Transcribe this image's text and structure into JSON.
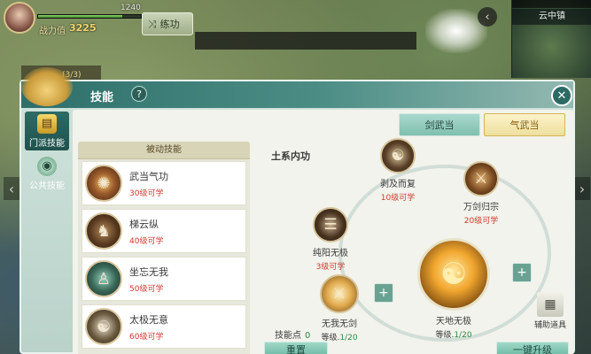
{
  "hud": {
    "hp_value": "1240",
    "hp_fraction": 0.82,
    "power_label": "战力值",
    "power_value": "3225",
    "practice_label": "练功",
    "quest_tab_label": "(3/3)"
  },
  "minimap": {
    "location": "云中镇"
  },
  "panel": {
    "title": "技能",
    "help_glyph": "?",
    "close_glyph": "✕",
    "side_tabs": [
      {
        "label": "门派技能",
        "icon": "scroll-icon"
      },
      {
        "label": "公共技能",
        "icon": "orb-icon"
      }
    ],
    "sect_buttons": {
      "sword": "剑武当",
      "qi": "气武当"
    },
    "passive": {
      "header": "被动技能",
      "items": [
        {
          "name": "武当气功",
          "requirement": "30级可学",
          "icon": "wudang-qigong-icon"
        },
        {
          "name": "梯云纵",
          "requirement": "40级可学",
          "icon": "tiyunzong-icon"
        },
        {
          "name": "坐忘无我",
          "requirement": "50级可学",
          "icon": "meditation-icon"
        },
        {
          "name": "太极无意",
          "requirement": "60级可学",
          "icon": "taiji-icon"
        }
      ]
    },
    "tree": {
      "title": "土系内功",
      "nodes": {
        "bofu": {
          "name": "剥及而复",
          "requirement": "10级可学"
        },
        "wanjian": {
          "name": "万剑归宗",
          "requirement": "20级可学"
        },
        "chunyang": {
          "name": "纯阳无极",
          "requirement": "3级可学"
        },
        "wuwujian": {
          "name": "无我无剑",
          "level_label": "等级.",
          "level": "1/20"
        },
        "tiandi": {
          "name": "天地无极",
          "level_label": "等级.",
          "level": "1/20"
        }
      }
    },
    "aux_tool_label": "辅助道具",
    "skill_points_label": "技能点",
    "skill_points_value": "0",
    "reset_label": "重置",
    "upgrade_all_label": "一键升级"
  },
  "colors": {
    "header": "#2f6f6a",
    "accent_gold": "#eedf9e",
    "requirement_red": "#d03a2c",
    "level_green": "#2e8a46"
  }
}
